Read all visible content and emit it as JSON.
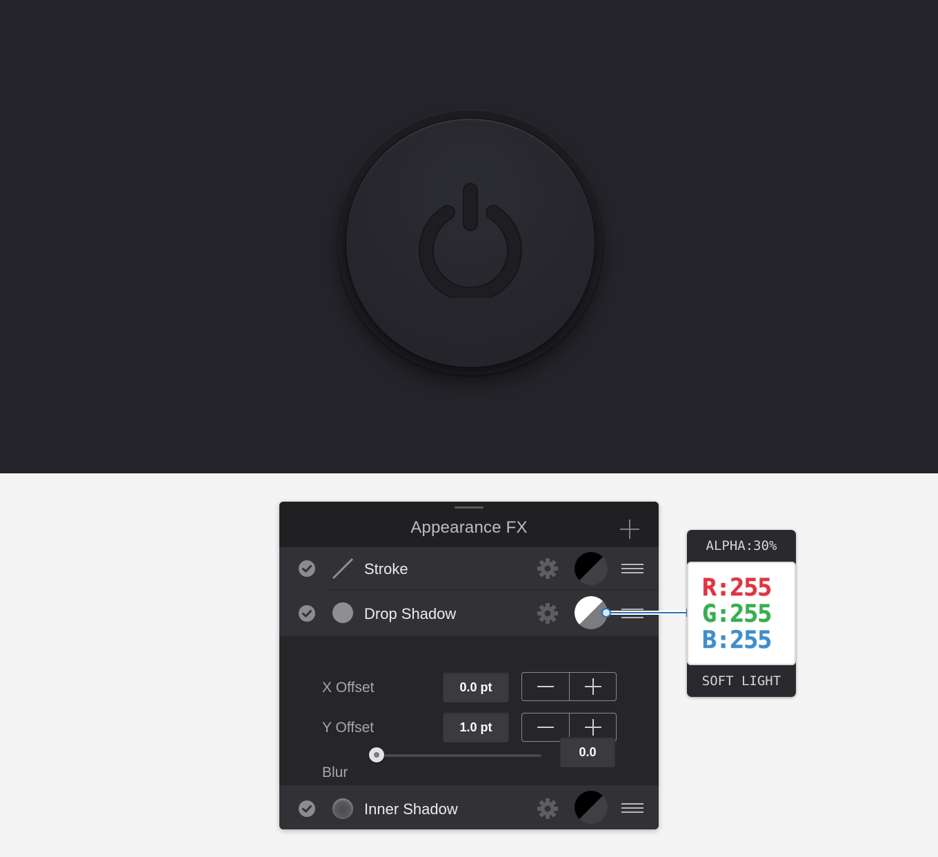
{
  "panel": {
    "title": "Appearance FX",
    "effects": [
      {
        "label": "Stroke",
        "enabled": true
      },
      {
        "label": "Drop Shadow",
        "enabled": true
      },
      {
        "label": "Inner Shadow",
        "enabled": true
      }
    ],
    "options": {
      "x_offset_label": "X Offset",
      "x_offset_value": "0.0 pt",
      "y_offset_label": "Y Offset",
      "y_offset_value": "1.0 pt",
      "blur_label": "Blur",
      "blur_value": "0.0",
      "blur_slider_fraction": 0.0
    }
  },
  "color_info": {
    "alpha": "ALPHA:30%",
    "r": "R:255",
    "g": "G:255",
    "b": "B:255",
    "blend_mode": "SOFT LIGHT"
  },
  "colors": {
    "canvas_bg": "#24242a",
    "panel_bg": "#262629",
    "red": "#e43340",
    "green": "#34b04c",
    "blue": "#3b8fd0"
  }
}
